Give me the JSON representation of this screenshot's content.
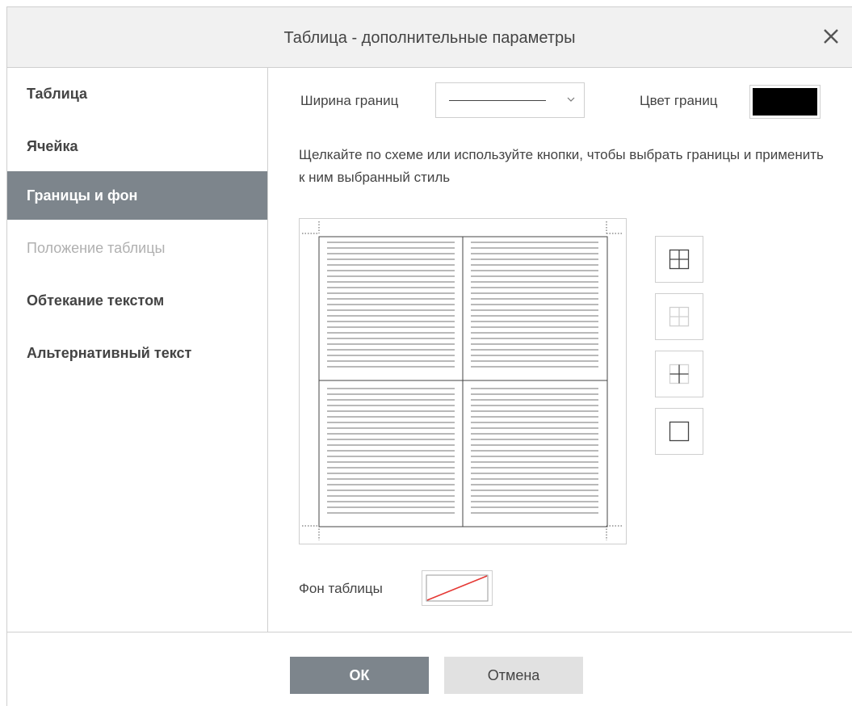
{
  "dialog": {
    "title": "Таблица - дополнительные параметры"
  },
  "sidebar": {
    "items": [
      {
        "label": "Таблица"
      },
      {
        "label": "Ячейка"
      },
      {
        "label": "Границы и фон"
      },
      {
        "label": "Положение таблицы"
      },
      {
        "label": "Обтекание текстом"
      },
      {
        "label": "Альтернативный текст"
      }
    ],
    "active_index": 2,
    "disabled_index": 3
  },
  "borders": {
    "width_label": "Ширина границ",
    "color_label": "Цвет границ",
    "color_value": "#000000",
    "description": "Щелкайте по схеме или используйте кнопки, чтобы выбрать границы и применить к ним выбранный стиль",
    "preset_icons": [
      "all-borders-icon",
      "no-borders-icon",
      "inner-borders-icon",
      "outer-borders-icon"
    ],
    "background_label": "Фон таблицы",
    "background_value": "none"
  },
  "footer": {
    "ok_label": "ОК",
    "cancel_label": "Отмена"
  },
  "colors": {
    "accent": "#7d858c",
    "border": "#cfcfcf",
    "text": "#444444"
  }
}
